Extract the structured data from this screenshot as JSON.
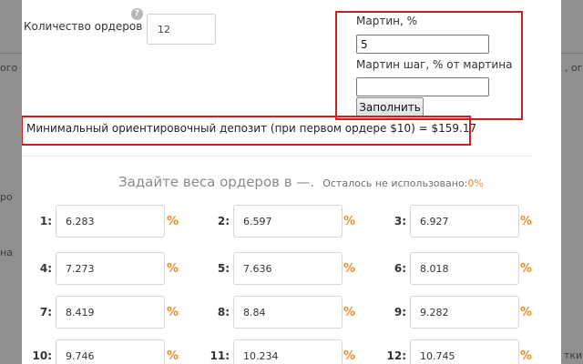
{
  "background": {
    "left_fragments": [
      "ого",
      "ро",
      "на"
    ],
    "right_fragments": [
      ", ог",
      "тки"
    ]
  },
  "orders": {
    "label": "Количество ордеров",
    "help_icon": "?",
    "value": "12"
  },
  "martin": {
    "label": "Мартин, %",
    "value": "5",
    "step_label": "Мартин шаг, % от мартина",
    "step_value": "",
    "fill_button": "Заполнить"
  },
  "deposit": {
    "text": "Минимальный ориентировочный депозит (при первом ордере $10) = $159.17"
  },
  "weights": {
    "title": "Задайте веса ордеров в —.",
    "remaining_label": "Осталось не использовано:",
    "remaining_value": "0%",
    "percent_sign": "%",
    "items": [
      {
        "label": "1:",
        "value": "6.283"
      },
      {
        "label": "2:",
        "value": "6.597"
      },
      {
        "label": "3:",
        "value": "6.927"
      },
      {
        "label": "4:",
        "value": "7.273"
      },
      {
        "label": "5:",
        "value": "7.636"
      },
      {
        "label": "6:",
        "value": "8.018"
      },
      {
        "label": "7:",
        "value": "8.419"
      },
      {
        "label": "8:",
        "value": "8.84"
      },
      {
        "label": "9:",
        "value": "9.282"
      },
      {
        "label": "10:",
        "value": "9.746"
      },
      {
        "label": "11:",
        "value": "10.234"
      },
      {
        "label": "12:",
        "value": "10.745"
      }
    ]
  },
  "colors": {
    "highlight_border": "#cc1f1f",
    "accent_orange": "#f08a24",
    "overlay": "#858585"
  }
}
